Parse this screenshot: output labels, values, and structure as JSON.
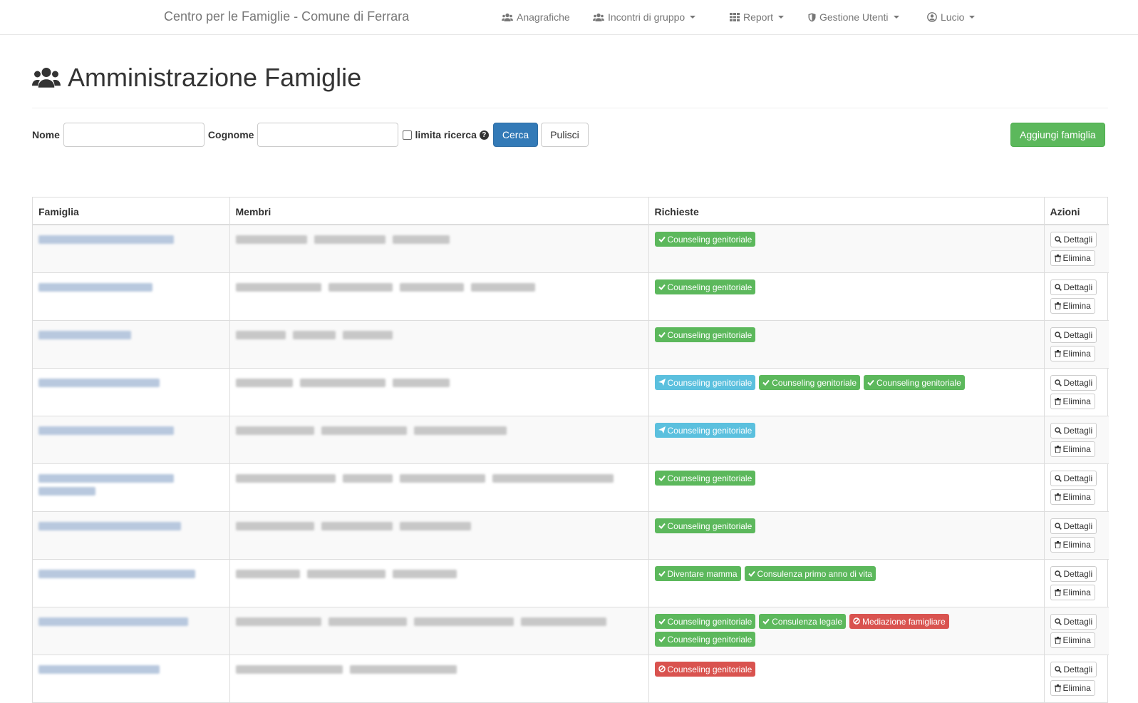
{
  "navbar": {
    "brand": "Centro per le Famiglie - Comune di Ferrara",
    "items": [
      {
        "label": "Anagrafiche",
        "icon": "users-icon",
        "dropdown": false
      },
      {
        "label": "Incontri di gruppo",
        "icon": "users-icon",
        "dropdown": true
      },
      {
        "label": "Report",
        "icon": "grid-icon",
        "dropdown": true
      },
      {
        "label": "Gestione Utenti",
        "icon": "shield-icon",
        "dropdown": true
      },
      {
        "label": "Lucio",
        "icon": "user-circle-icon",
        "dropdown": true
      }
    ]
  },
  "header": {
    "title": "Amministrazione Famiglie",
    "icon": "users-icon"
  },
  "search": {
    "nome_label": "Nome",
    "nome_value": "",
    "cognome_label": "Cognome",
    "cognome_value": "",
    "limit_label": "limita ricerca",
    "limit_checked": false,
    "search_button": "Cerca",
    "clear_button": "Pulisci",
    "add_button": "Aggiungi famiglia"
  },
  "table": {
    "columns": [
      "Famiglia",
      "Membri",
      "Richieste",
      "Azioni"
    ],
    "action_details": "Dettagli",
    "action_delete": "Elimina",
    "rows": [
      {
        "requests": [
          {
            "label": "Counseling genitoriale",
            "status": "success"
          }
        ]
      },
      {
        "requests": [
          {
            "label": "Counseling genitoriale",
            "status": "success"
          }
        ]
      },
      {
        "requests": [
          {
            "label": "Counseling genitoriale",
            "status": "success"
          }
        ]
      },
      {
        "requests": [
          {
            "label": "Counseling genitoriale",
            "status": "sent"
          },
          {
            "label": "Counseling genitoriale",
            "status": "success"
          },
          {
            "label": "Counseling genitoriale",
            "status": "success"
          }
        ]
      },
      {
        "requests": [
          {
            "label": "Counseling genitoriale",
            "status": "sent"
          }
        ]
      },
      {
        "requests": [
          {
            "label": "Counseling genitoriale",
            "status": "success"
          }
        ]
      },
      {
        "requests": [
          {
            "label": "Counseling genitoriale",
            "status": "success"
          }
        ]
      },
      {
        "requests": [
          {
            "label": "Diventare mamma",
            "status": "success"
          },
          {
            "label": "Consulenza primo anno di vita",
            "status": "success"
          }
        ]
      },
      {
        "requests": [
          {
            "label": "Counseling genitoriale",
            "status": "success"
          },
          {
            "label": "Consulenza legale",
            "status": "success"
          },
          {
            "label": "Mediazione famigliare",
            "status": "rejected"
          },
          {
            "label": "Counseling genitoriale",
            "status": "success"
          }
        ]
      },
      {
        "requests": [
          {
            "label": "Counseling genitoriale",
            "status": "rejected"
          }
        ]
      }
    ]
  },
  "colors": {
    "primary": "#337ab7",
    "success": "#5cb85c",
    "info": "#5bc0de",
    "danger": "#d9534f"
  }
}
